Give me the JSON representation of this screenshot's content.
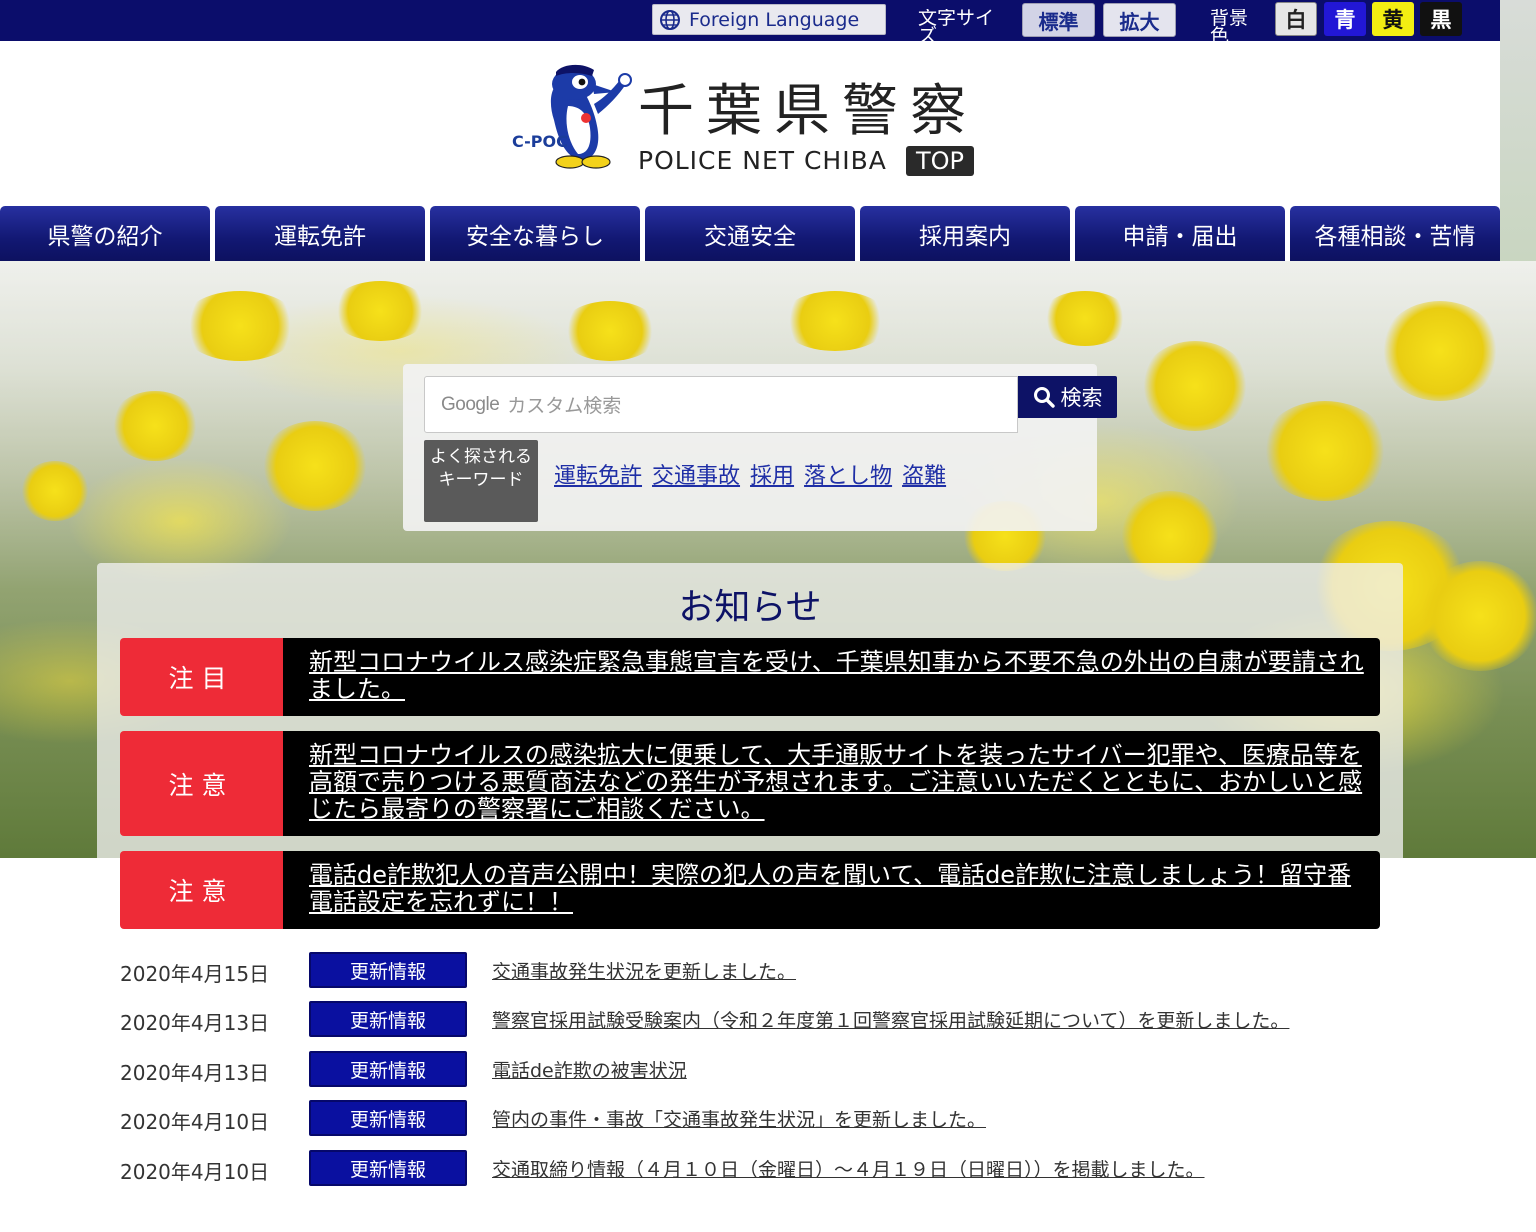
{
  "topbar": {
    "foreign_language": "Foreign Language",
    "font_size_label": "文字サイズ",
    "font_standard": "標準",
    "font_large": "拡大",
    "bg_color_label": "背景色",
    "colors": [
      {
        "label": "白",
        "hex": "#e6e6e6"
      },
      {
        "label": "青",
        "hex": "#2217d6"
      },
      {
        "label": "黄",
        "hex": "#f3ee12"
      },
      {
        "label": "黒",
        "hex": "#111111"
      }
    ]
  },
  "header": {
    "logo_title": "千葉県警察",
    "logo_subtitle": "POLICE NET CHIBA",
    "logo_tag": "TOP",
    "mascot_label": "C-POC"
  },
  "nav": {
    "items": [
      "県警の紹介",
      "運転免許",
      "安全な暮らし",
      "交通安全",
      "採用案内",
      "申請・届出",
      "各種相談・苦情"
    ]
  },
  "search": {
    "placeholder": "カスタム検索",
    "google_label": "Google",
    "button_label": "検索",
    "keyword_badge": "よく探されるキーワード",
    "keywords": [
      "運転免許",
      "交通事故",
      "採用",
      "落とし物",
      "盗難"
    ]
  },
  "notices": {
    "title": "お知らせ",
    "alerts": [
      {
        "tag": "注目",
        "text": "新型コロナウイルス感染症緊急事態宣言を受け、千葉県知事から不要不急の外出の自粛が要請されました。"
      },
      {
        "tag": "注意",
        "text": "新型コロナウイルスの感染拡大に便乗して、大手通販サイトを装ったサイバー犯罪や、医療品等を高額で売りつける悪質商法などの発生が予想されます。ご注意いいただくとともに、おかしいと感じたら最寄りの警察署にご相談ください。"
      },
      {
        "tag": "注意",
        "text": "電話de詐欺犯人の音声公開中！実際の犯人の声を聞いて、電話de詐欺に注意しましょう！留守番電話設定を忘れずに！！"
      }
    ]
  },
  "updates": [
    {
      "date": "2020年4月15日",
      "badge": "更新情報",
      "text": "交通事故発生状況を更新しました。"
    },
    {
      "date": "2020年4月13日",
      "badge": "更新情報",
      "text": "警察官採用試験受験案内（令和２年度第１回警察官採用試験延期について）を更新しました。"
    },
    {
      "date": "2020年4月13日",
      "badge": "更新情報",
      "text": "電話de詐欺の被害状況"
    },
    {
      "date": "2020年4月10日",
      "badge": "更新情報",
      "text": "管内の事件・事故「交通事故発生状況」を更新しました。"
    },
    {
      "date": "2020年4月10日",
      "badge": "更新情報",
      "text": "交通取締り情報（４月１０日（金曜日）～４月１９日（日曜日））を掲載しました。"
    }
  ]
}
